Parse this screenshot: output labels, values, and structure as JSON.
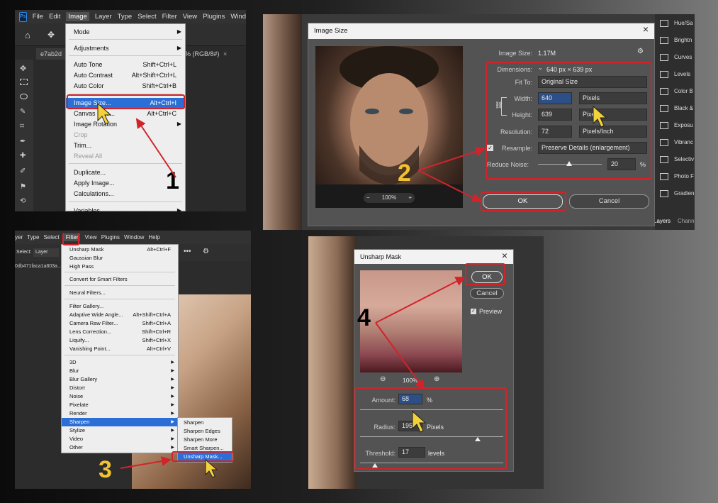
{
  "panel1": {
    "menubar": [
      "File",
      "Edit",
      "Image",
      "Layer",
      "Type",
      "Select",
      "Filter",
      "View",
      "Plugins",
      "Wind"
    ],
    "doc_tab": "e7ab2d",
    "doc_tab_right": "% (RGB/8#)",
    "menu": [
      {
        "label": "Mode",
        "sc": "",
        "sub": true
      },
      {
        "label": "Adjustments",
        "sc": "",
        "sub": true
      },
      {
        "label": "Auto Tone",
        "sc": "Shift+Ctrl+L"
      },
      {
        "label": "Auto Contrast",
        "sc": "Alt+Shift+Ctrl+L"
      },
      {
        "label": "Auto Color",
        "sc": "Shift+Ctrl+B"
      },
      {
        "label": "Image Size...",
        "sc": "Alt+Ctrl+I"
      },
      {
        "label": "Canvas Size...",
        "sc": "Alt+Ctrl+C"
      },
      {
        "label": "Image Rotation",
        "sc": "",
        "sub": true
      },
      {
        "label": "Crop",
        "sc": "",
        "dis": true
      },
      {
        "label": "Trim...",
        "sc": ""
      },
      {
        "label": "Reveal All",
        "sc": "",
        "dis": true
      },
      {
        "label": "Duplicate...",
        "sc": ""
      },
      {
        "label": "Apply Image...",
        "sc": ""
      },
      {
        "label": "Calculations...",
        "sc": ""
      },
      {
        "label": "Variables",
        "sc": "",
        "sub": true
      }
    ],
    "step": "1"
  },
  "panel2": {
    "title": "Image Size",
    "image_size_label": "Image Size:",
    "image_size_value": "1.17M",
    "dimensions_label": "Dimensions:",
    "dimensions_value": "640 px  ×  639 px",
    "fit_to_label": "Fit To:",
    "fit_to_value": "Original Size",
    "width_label": "Width:",
    "width_value": "640",
    "width_unit": "Pixels",
    "height_label": "Height:",
    "height_value": "639",
    "height_unit": "Pixels",
    "resolution_label": "Resolution:",
    "resolution_value": "72",
    "resolution_unit": "Pixels/Inch",
    "resample_label": "Resample:",
    "resample_value": "Preserve Details (enlargement)",
    "reduce_noise_label": "Reduce Noise:",
    "reduce_noise_value": "20",
    "reduce_noise_unit": "%",
    "ok": "OK",
    "cancel": "Cancel",
    "zoom": "100%",
    "side_panel": [
      "Hue/Sa",
      "Brightn",
      "Curves",
      "Levels",
      "Color B",
      "Black &",
      "Exposu",
      "Vibranc",
      "Selectiv",
      "Photo F",
      "Gradien"
    ],
    "side_tabs": [
      "Layers",
      "Chann"
    ],
    "step": "2"
  },
  "panel3": {
    "menubar": [
      "yer",
      "Type",
      "Select",
      "Filter",
      "View",
      "Plugins",
      "Window",
      "Help"
    ],
    "options_label": "Select:",
    "options_value": "Layer",
    "doc_name": "0db471faca1a803a...",
    "menu": [
      {
        "label": "Unsharp Mask",
        "sc": "Alt+Ctrl+F"
      },
      {
        "label": "Gaussian Blur",
        "sc": ""
      },
      {
        "label": "High Pass",
        "sc": ""
      },
      {
        "label": "Convert for Smart Filters",
        "sc": ""
      },
      {
        "label": "Neural Filters...",
        "sc": ""
      },
      {
        "label": "Filter Gallery...",
        "sc": ""
      },
      {
        "label": "Adaptive Wide Angle...",
        "sc": "Alt+Shift+Ctrl+A"
      },
      {
        "label": "Camera Raw Filter...",
        "sc": "Shift+Ctrl+A"
      },
      {
        "label": "Lens Correction...",
        "sc": "Shift+Ctrl+R"
      },
      {
        "label": "Liquify...",
        "sc": "Shift+Ctrl+X"
      },
      {
        "label": "Vanishing Point...",
        "sc": "Alt+Ctrl+V"
      },
      {
        "label": "3D",
        "sc": "",
        "sub": true
      },
      {
        "label": "Blur",
        "sc": "",
        "sub": true
      },
      {
        "label": "Blur Gallery",
        "sc": "",
        "sub": true
      },
      {
        "label": "Distort",
        "sc": "",
        "sub": true
      },
      {
        "label": "Noise",
        "sc": "",
        "sub": true
      },
      {
        "label": "Pixelate",
        "sc": "",
        "sub": true
      },
      {
        "label": "Render",
        "sc": "",
        "sub": true
      },
      {
        "label": "Sharpen",
        "sc": "",
        "sub": true
      },
      {
        "label": "Stylize",
        "sc": "",
        "sub": true
      },
      {
        "label": "Video",
        "sc": "",
        "sub": true
      },
      {
        "label": "Other",
        "sc": "",
        "sub": true
      }
    ],
    "submenu": [
      "Sharpen",
      "Sharpen Edges",
      "Sharpen More",
      "Smart Sharpen...",
      "Unsharp Mask..."
    ],
    "step": "3"
  },
  "panel4": {
    "title": "Unsharp Mask",
    "ok": "OK",
    "cancel": "Cancel",
    "preview": "Preview",
    "zoom": "100%",
    "amount_label": "Amount:",
    "amount_value": "68",
    "amount_unit": "%",
    "radius_label": "Radius:",
    "radius_value": "195.",
    "radius_unit": "Pixels",
    "threshold_label": "Threshold:",
    "threshold_value": "17",
    "threshold_unit": "levels",
    "step": "4"
  },
  "colors": {
    "accent_red": "#d2232a",
    "step_yellow": "#f2c230",
    "highlight_blue": "#2b6fd6"
  }
}
